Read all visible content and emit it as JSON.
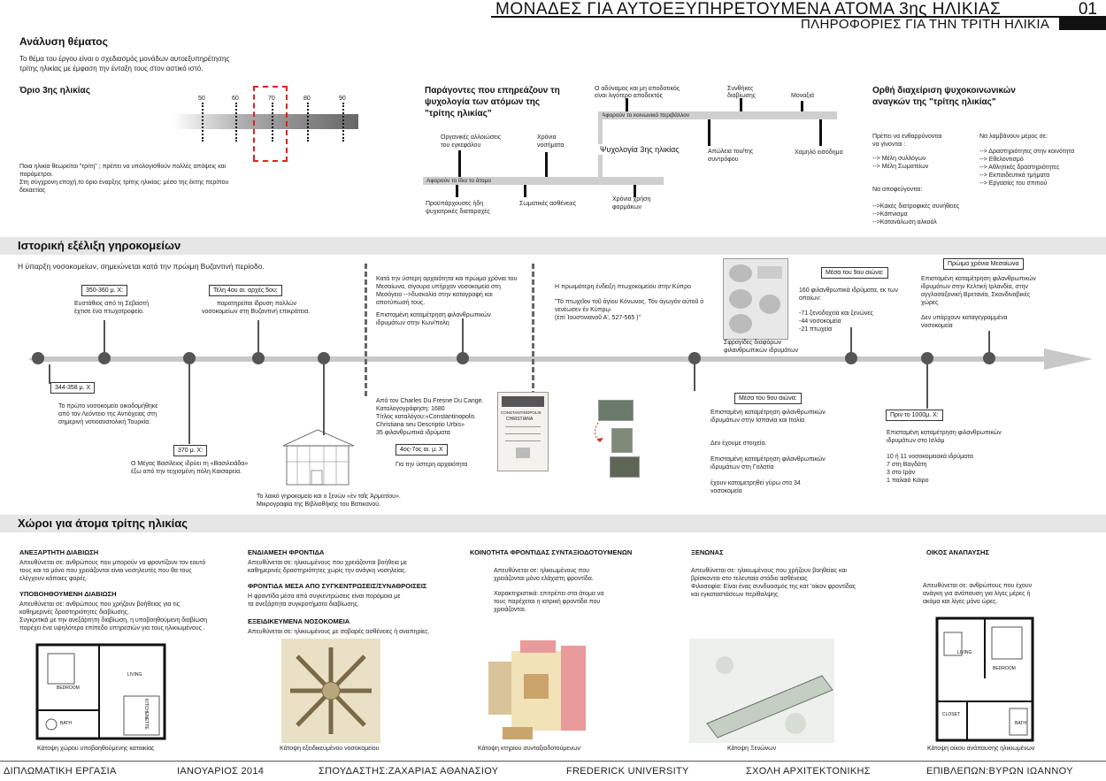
{
  "header": {
    "title": "ΜΟΝΑΔΕΣ ΓΙΑ ΑΥΤΟΕΞΥΠΗΡΕΤΟΥΜΕΝΑ ΑΤΟΜΑ 3ης ΗΛΙΚΙΑΣ",
    "number": "01",
    "subtitle": "ΠΛΗΡΟΦΟΡΙΕΣ ΓΙΑ ΤΗΝ ΤΡΙΤΗ ΗΛΙΚΙΑ"
  },
  "analysis": {
    "title": "Ανάλυση θέματος",
    "text1": "Το θέμα του έργου είναι ο σχεδιασμός μονάδων αυτοεξυπηρέτησης",
    "text2": "τρίτης ηλικίας με έμφαση την ένταξη τους στον αστικό ιστό."
  },
  "age_limit": {
    "title": "Όριο 3ης ηλικίας",
    "ticks": [
      "50",
      "60",
      "70",
      "80",
      "90"
    ],
    "note1": "Ποια ηλικία θεωρείται \"τρίτη\" ; πρέπει να υπολογισθούν πολλές απόψεις και",
    "note2": "παράμετροι.",
    "note3": "Στη σύγχρονη εποχή,το όριο έναρξης τρίτης ηλικίας: μέσο της έκτης περίπου",
    "note4": "δεκαετίας"
  },
  "factors": {
    "title1": "Παράγοντες που επηρεάζουν τη",
    "title2": "ψυχολογία των ατόμων της",
    "title3": "\"τρίτης ηλικίας\"",
    "bar1": "Αφορούν το ίδιο το άτομο",
    "bar2": "Αφορούν το κοινωνικό περιβάλλον",
    "center": "Ψυχολογία 3ης ηλικίας",
    "f1a": "Οργανικές αλλοιώσεις",
    "f1b": "του εγκεφάλου",
    "f2a": "Χρόνια",
    "f2b": "νοσήματα",
    "f3a": "Προϋπάρχουσες ήδη",
    "f3b": "ψυχιατρικές διαταραχές",
    "f4": "Σωματικές ασθένειες",
    "f5a": "Χρόνια χρήση",
    "f5b": "φαρμάκων",
    "f6a": "Ο αδύναμος και μη αποδοτικός",
    "f6b": "είναι λιγότερο αποδεκτός",
    "f7a": "Συνθήκες",
    "f7b": "διαβίωσης",
    "f8": "Μοναξιά",
    "f9a": "Απώλεια του/της",
    "f9b": "συντρόφου",
    "f10": "Χαμηλό εισόδημα"
  },
  "management": {
    "title1": "Ορθή διαχείριση ψυχοκοινωνικών",
    "title2": "αναγκών της \"τρίτης ηλικίας\"",
    "l1": "Πρέπει να ενθαρρύνονται",
    "l2": "να γίνονται :",
    "l3": "-->  Μέλη συλλόγων",
    "l4": "-->  Μέλη Σωματείων",
    "l5": "Να αποφεύγονται:",
    "l6": "-->Κακές διατροφικές συνήθειες",
    "l7": "-->Κάπνισμα",
    "l8": "-->Κατανάλωση αλκοόλ",
    "r1": "Να λαμβάνουν μέρος σε:",
    "r2": "--> Δραστηριότητες στην κοινότητα",
    "r3": "--> Εθελοντισμό",
    "r4": "--> Αθλητικές δραστηριότητες",
    "r5": "--> Εκπαιδευτικά τμήματα",
    "r6": "--> Εργασίες του σπιτιού"
  },
  "history": {
    "band_title": "Ιστορική εξέλιξη γηροκομείων",
    "intro": "Η ύπαρξη νοσοκομείων, σημειώνεται κατά την πρώιμη Βυζαντινή περίοδο.",
    "e1_date": "350-360 μ. Χ:",
    "e1a": "Ευστάθιος από τη Σεβαστή",
    "e1b": "έχτισε ένα πτωχοτροφείο.",
    "e2_date": "Τέλη 4ου αι. αρχές 5ου:",
    "e2a": "παρατηρείται ίδρυση πολλών",
    "e2b": "νοσοκομείων στη Βυζαντινή επικράτεια.",
    "e3a": "Κατά την ύστερη αρχαιότητα και πρώιμα χρόνια του",
    "e3b": "Μεσαίωνα, σίγουρα υπήρχαν νοσοκομεία στη",
    "e3c": "Μεσόγειο -->δυσκολία στην καταγραφή και",
    "e3d": "αποτύπωσή τους.",
    "e3e": "Επισταμένη καταμέτρηση φιλανθρωπικών",
    "e3f": "ιδρυμάτων στην Κων/πολη",
    "e4a": "Η πρωιμότερη ένδειξη πτωχοκομείου στην Κύπρο",
    "e4b": "\"Τό πτωχεῖον τοῦ ἁγίου Κόνωνος. Τόν ἀγωγόν αὐτοῦ ὁ",
    "e4c": "νενέωσεν ἐν Κύπρῳ",
    "e4d": "(ἐπί Ἰουστινιανοῦ Α', 527-565 )\"",
    "seals": "Σφραγίδες διαφόρων",
    "seals2": "φιλανθρωπικών ιδρυμάτων",
    "e5_date": "Μέσα του 9ου αιώνα:",
    "e5a": "160 φιλανθρωπικά ιδρύματα, εκ των",
    "e5b": "οποίων:",
    "e5c": "-71 ξενοδοχεία και ξενώνες",
    "e5d": "-44 νοσοκομεία",
    "e5e": "-21 πτωχεία",
    "e6_date": "Πρώιμα χρόνια Μεσαίωνα",
    "e6a": "Επισταμένη καταμέτρηση φιλανθρωπικών",
    "e6b": "ιδρυμάτων στην Κελτική Ιρλανδία, στην",
    "e6c": "αγγλοσαξονική Βρετανία, Σκανδιναβικές",
    "e6d": "χώρες",
    "e6e": "Δεν υπάρχουν καταγεγραμμένα",
    "e6f": "νοσοκομεία",
    "b1_date": "344-358 μ. Χ",
    "b1a": "Το πρώτο νοσοκομείο οικοδομήθηκε",
    "b1b": "από τον Λεόντειο της Αντιόχειας στη",
    "b1c": "σημερινή νοτιοανατολική Τουρκία.",
    "b2_date": "370  μ. Χ:",
    "b2a": "Ο Μέγας Βασίλειος ιδρύει τη «Βασιλειάδα»",
    "b2b": "έξω από την τειχισμένη πόλη Καισαρεία.",
    "b3a": "Το λαικό γηροκομείο και ο ξενών «ἐν ταῖς Ἀρματίου».",
    "b3b": "Μικρογραφία της Βιβλιοθήκης του Βατικανού.",
    "b4a": "Από τον Charles Du Fresne Du Cange.",
    "b4b": "Καταλογογράφηση: 1680",
    "b4c": "Τίτλος καταλόγου:«Constantinopolis",
    "b4d": "Christiana seu Descriptio Urbis»",
    "b4e": "35 φιλανθρωπικά ιδρύματα",
    "b5_date": "4ος-7ος αι. μ. Χ",
    "b5a": "Για την ύστερη αρχαιότητα",
    "b6_date": "Μέσα του 9ου αιώνα:",
    "b6a": "Επισταμένη καταμέτρηση φιλανθρωπικών",
    "b6b": "ιδρυμάτων στην Ισπανία και Ιταλία",
    "b6c": "Δεν έχουμε στοιχεία.",
    "b6d": "Επισταμένη καταμέτρηση φιλανθρωπικών",
    "b6e": "ιδρυμάτων στη Γαλατία",
    "b6f": "έχουν καταμετρηθεί γύρω στα 34",
    "b6g": "νοσοκομεία",
    "b7_date": "Πριν το 1000μ. Χ:",
    "b7a": "Επισταμένη καταμέτρηση φιλανθρωπικών",
    "b7b": "ιδρυμάτων στο Ισλάμ",
    "b7c": "10 ή 11 νοσοκομειακά ιδρύματα",
    "b7d": "7    στη Βαγδάτη",
    "b7e": "3    στο Ιράν",
    "b7f": "1    παλαιό Κάιρο",
    "book1": "CONSTANTINOPOLIS",
    "book2": "CHRISTIANA"
  },
  "spaces": {
    "band_title": "Χώροι για άτομα τρίτης ηλικίας",
    "c1_t": "ΑΝΕΞΑΡΤΗΤΗ ΔΙΑΒΙΩΣΗ",
    "c1a": "Απευθύνεται σε:   ανθρώπους που μπορούν να φροντίζουν τον εαυτό",
    "c1b": "τους και τα μόνο που χρειάζονται είναι νοσηλευτές που θα τους",
    "c1c": "ελέγχουν κάποιες φορές.",
    "c1_t2": "ΥΠΟΒΟΗΘΟΥΜΕΝΗ ΔΙΑΒΙΩΣΗ",
    "c1d": "Απευθύνεται σε:   ανθρώπους που χρήζουν βοήθειας για τις",
    "c1e": "καθημερινές δραστηριότητες διαβίωσης.",
    "c1f": "Συγκριτικά με την ανεξάρτητη διαβίωση, η υποβοηθούμενη διαβίωση",
    "c1g": "παρέχει ένα υψηλότερο επίπεδο υπηρεσιών για τους ηλικιωμένους .",
    "c1_cap": "Κάτοψη χώρου υποβοηθούμενης κατοικίας",
    "c2_t": "ΕΝΔΙΑΜΕΣΗ ΦΡΟΝΤΙΔΑ",
    "c2a": "Απευθύνεται σε:  ηλικιωμένους που χρειάζονται βοήθεια με",
    "c2b": "καθημερινές δραστηριότητες χωρίς την ανάγκη νοσηλείας.",
    "c2_t2": "ΦΡΟΝΤΙΔΑ ΜΕΣΑ ΑΠΟ ΣΥΓΚΕΝΤΡΩΣΕΙΣ/ΣΥΝΑΘΡΟΙΣΕΙΣ",
    "c2c": "Η φροντίδα μέσα από συγκεντρώσεις είναι πορόμοια με",
    "c2d": "τα ανεξάρτητα συγκροτήματα διαβίωσης.",
    "c2_t3": "ΕΞΕΙΔΙΚΕΥΜΕΝΑ ΝΟΣΟΚΟΜΕΙΑ",
    "c2e": "Απευθύνεται σε:    ηλικιωμένους με σοβαρές ασθένειες ή αναπηρίες.",
    "c2_cap": "Κάτοψη εξειδικευμένου νοσοκομείου",
    "c3_t": "ΚΟΙΝΟΤΗΤΑ ΦΡΟΝΤΙΔΑΣ ΣΥΝΤΑΞΙΟΔΟΤΟΥΜΕΝΩΝ",
    "c3a": "Απευθύνεται σε:  ηλικιωμένους που",
    "c3b": "χρειάζονται μόνο ελάχιστη φροντίδα.",
    "c3c": "Χαρακτηριστικά: επιτρέπει στα άτομα να",
    "c3d": "τους παρέχεται η ιατρική φροντίδα που",
    "c3e": "χρειάζονται.",
    "c3_cap": "Κάτοψη κτηρίου συνταξιοδοτούμενων",
    "c4_t": "ΞΕΝΩΝΑΣ",
    "c4a": "Απευθύνεται σε:   ηλικιωμένους που χρήζουν βοηθείας  και",
    "c4b": "βρίσκονται στο τελευταίο στάδιο ασθένειας",
    "c4c": "Φιλοσοφία: Είναι ένας συνδυασμός της κατ 'οίκον φροντίδας",
    "c4d": "και εγκαταστάσεων περίθαλψης",
    "c4_cap": "Κάτοψη Ξενώνων",
    "c5_t": "ΟΙΚΟΣ ΑΝΑΠΑΥΣΗΣ",
    "c5a": "Απευθύνεται σε:  ανθρώπους που έχουν",
    "c5b": "ανάγκη για ανάπαυση για λίγες μέρες ή",
    "c5c": "ακόμα και λίγες μόνο ώρες.",
    "c5_cap": "Κάτοψη οίκου ανάπαυσης ηλικιωμένων",
    "plan_bedroom": "BEDROOM",
    "plan_living": "LIVING",
    "plan_bath": "BATH",
    "plan_kitchen": "KITCHENETTE",
    "plan_closet": "CLOSET"
  },
  "footer": {
    "f1": "ΔΙΠΛΩΜΑΤΙΚΗ ΕΡΓΑΣΙΑ",
    "f2": "ΙΑΝΟΥΑΡΙΟΣ 2014",
    "f3": "ΣΠΟΥΔΑΣΤΗΣ:ΖΑΧΑΡΙΑΣ ΑΘΑΝΑΣΙΟΥ",
    "f4": "FREDERICK UNIVERSITY",
    "f5": "ΣΧΟΛΗ ΑΡΧΙΤΕΚΤΟΝΙΚΗΣ",
    "f6": "ΕΠΙΒΛΕΠΩΝ:ΒΥΡΩΝ ΙΩΑΝΝΟΥ"
  },
  "colors": {
    "accent_red": "#e02020",
    "band": "#e6e6e6",
    "timeline": "#c8c8c8",
    "node": "#555555"
  }
}
